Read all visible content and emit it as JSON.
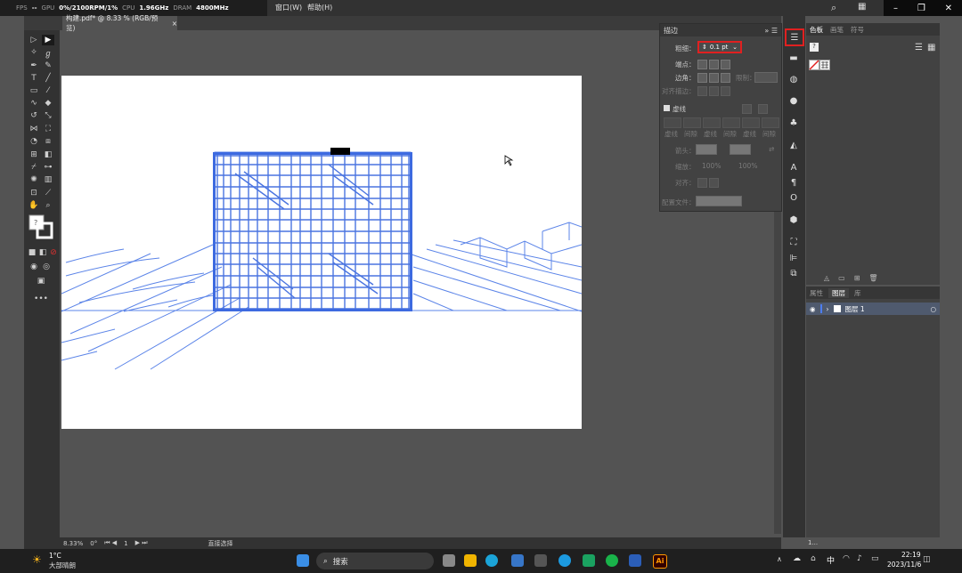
{
  "overlay": {
    "fps_label": "FPS",
    "fps_value": "--",
    "gpu_label": "GPU",
    "gpu_value": "0%/2100RPM/1%",
    "cpu_label": "CPU",
    "cpu_value": "1.96GHz",
    "dram_label": "DRAM",
    "dram_value": "4800MHz"
  },
  "menu": {
    "window": "窗口(W)",
    "help": "帮助(H)"
  },
  "document": {
    "tab_title": "构建.pdf* @ 8.33 % (RGB/预览)",
    "close": "×"
  },
  "stroke_panel": {
    "title": "描边",
    "weight_label": "粗细：",
    "weight_value": "0.1 pt",
    "cap_label": "端点：",
    "corner_label": "边角：",
    "limit_label": "限制：",
    "align_label": "对齐描边：",
    "dashed_label": "虚线",
    "dash_labels": [
      "虚线",
      "间隙",
      "虚线",
      "间隙",
      "虚线",
      "间隙"
    ],
    "arrow_label": "箭头：",
    "scale_label": "缩放：",
    "scale_value_1": "100%",
    "scale_value_2": "100%",
    "align2_label": "对齐：",
    "profile_label": "配置文件："
  },
  "swatch_panel": {
    "tabs": [
      "色板",
      "画笔",
      "符号"
    ]
  },
  "layers_panel": {
    "tabs": [
      "属性",
      "图层",
      "库"
    ],
    "layer_name": "图层 1",
    "footer_count": "1..."
  },
  "status": {
    "zoom": "8.33%",
    "rotate": "0°",
    "page": "1",
    "tool": "直接选择"
  },
  "taskbar": {
    "weather_temp": "1°C",
    "weather_desc": "大部晴朗",
    "search_placeholder": "搜索",
    "ime": "中",
    "time": "22:19",
    "date": "2023/11/6"
  }
}
